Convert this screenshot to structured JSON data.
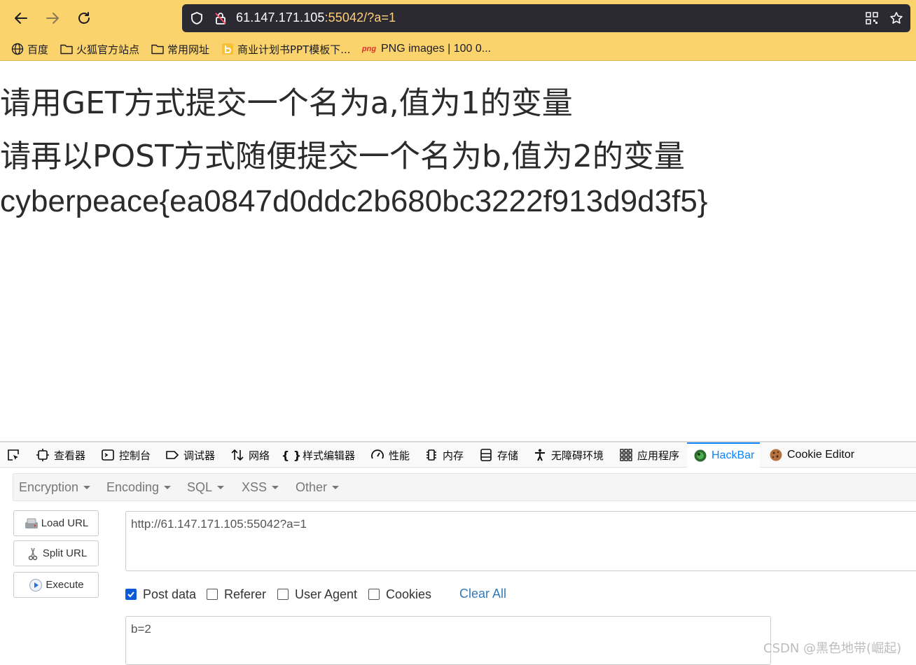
{
  "browser": {
    "url_main": "61.147.171.105",
    "url_rest": ":55042/?a=1",
    "bookmarks": [
      {
        "label": "百度",
        "icon": "globe-icon"
      },
      {
        "label": "火狐官方站点",
        "icon": "folder-icon"
      },
      {
        "label": "常用网址",
        "icon": "folder-icon"
      },
      {
        "label": "商业计划书PPT模板下...",
        "icon": "bookmark-favicon-icon"
      },
      {
        "label": "PNG images | 100 0...",
        "icon": "png-favicon-icon",
        "icon_text": "png"
      }
    ]
  },
  "page": {
    "line1": "请用GET方式提交一个名为a,值为1的变量",
    "line2": "请再以POST方式随便提交一个名为b,值为2的变量",
    "flag": "cyberpeace{ea0847d0ddc2b680bc3222f913d9d3f5}"
  },
  "devtools": {
    "tabs": [
      {
        "label": "查看器"
      },
      {
        "label": "控制台"
      },
      {
        "label": "调试器"
      },
      {
        "label": "网络"
      },
      {
        "label": "样式编辑器"
      },
      {
        "label": "性能"
      },
      {
        "label": "内存"
      },
      {
        "label": "存储"
      },
      {
        "label": "无障碍环境"
      },
      {
        "label": "应用程序"
      },
      {
        "label": "HackBar"
      },
      {
        "label": "Cookie Editor"
      }
    ],
    "active_tab": "HackBar",
    "accent": "#0a84ff"
  },
  "hackbar": {
    "menu": [
      "Encryption",
      "Encoding",
      "SQL",
      "XSS",
      "Other"
    ],
    "buttons": {
      "load": "Load URL",
      "split": "Split URL",
      "execute": "Execute"
    },
    "url_value": "http://61.147.171.105:55042?a=1",
    "options": [
      {
        "label": "Post data",
        "checked": true
      },
      {
        "label": "Referer",
        "checked": false
      },
      {
        "label": "User Agent",
        "checked": false
      },
      {
        "label": "Cookies",
        "checked": false
      }
    ],
    "clear_all": "Clear All",
    "post_value": "b=2"
  },
  "watermark": "CSDN @黑色地带(崛起)"
}
